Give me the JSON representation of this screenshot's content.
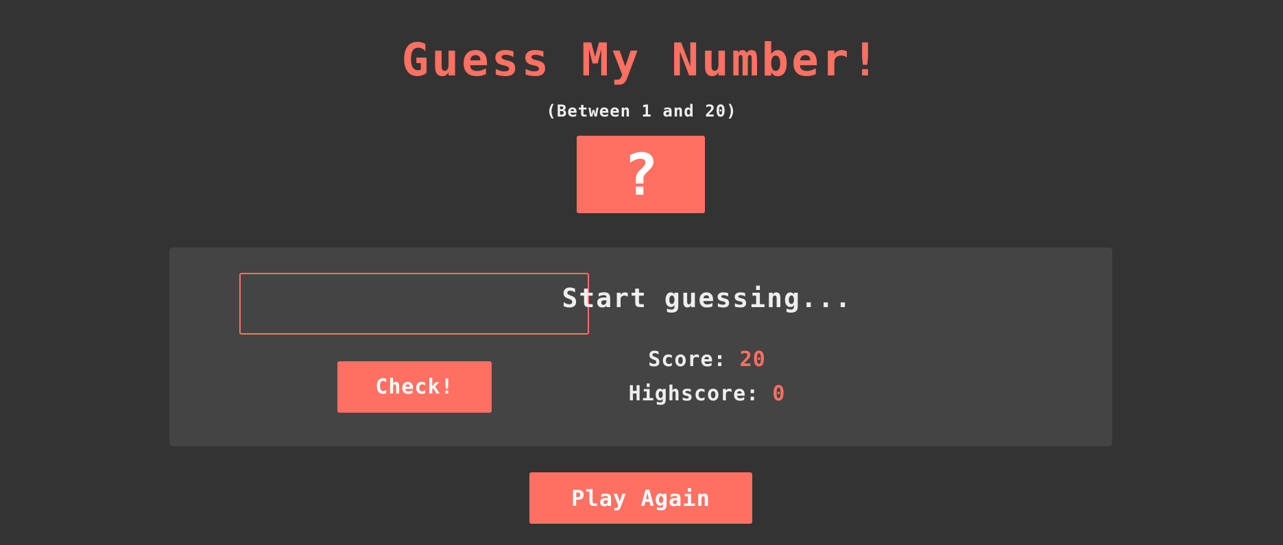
{
  "header": {
    "title": "Guess My Number!",
    "subtitle": "(Between 1 and 20)"
  },
  "secret_number": {
    "display": "?"
  },
  "guess_input": {
    "value": "",
    "placeholder": ""
  },
  "buttons": {
    "check_label": "Check!",
    "again_label": "Play Again"
  },
  "status": {
    "message": "Start guessing...",
    "score_label": "Score:",
    "score_value": "20",
    "highscore_label": "Highscore:",
    "highscore_value": "0"
  },
  "colors": {
    "background": "#333333",
    "panel": "#444444",
    "accent": "#ff7062",
    "text": "#eeeeee"
  }
}
